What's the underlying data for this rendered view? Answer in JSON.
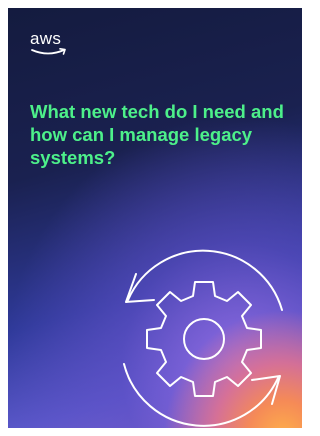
{
  "cover": {
    "logo_text": "aws",
    "headline": "What new tech do I need and how can I manage legacy systems?",
    "illustration_icon": "gear-refresh-icon"
  },
  "colors": {
    "headline": "#4df08a",
    "background_dark": "#141b3f",
    "background_purple": "#5a57c9",
    "glow_orange": "#ffb14a",
    "line_art": "#ffffff"
  }
}
